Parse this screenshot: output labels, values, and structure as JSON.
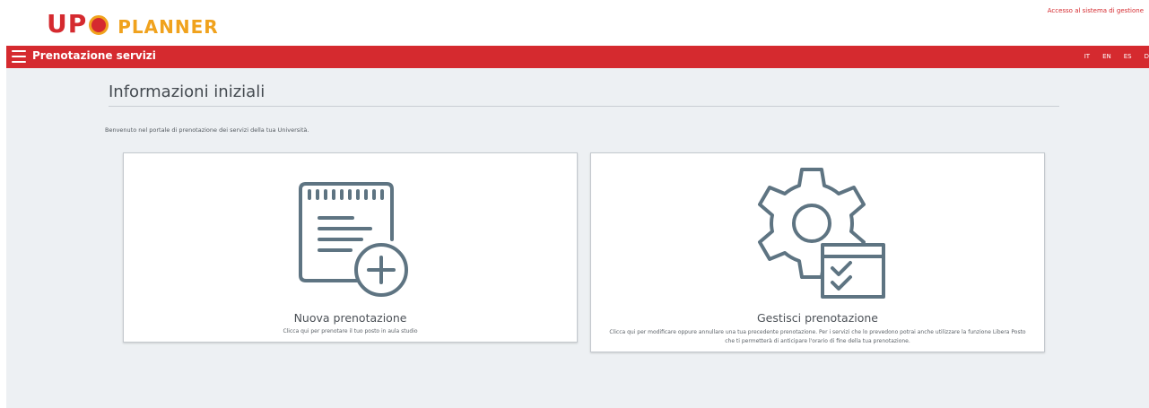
{
  "header": {
    "logo_upo": "UP",
    "logo_planner": "PLANNER",
    "admin_link": "Accesso al sistema di gestione"
  },
  "navbar": {
    "title": "Prenotazione servizi",
    "languages": [
      "IT",
      "EN",
      "ES",
      "D"
    ]
  },
  "main": {
    "page_title": "Informazioni iniziali",
    "intro": "Benvenuto nel portale di prenotazione dei servizi della tua Università.",
    "cards": [
      {
        "icon": "new-booking-icon",
        "title": "Nuova prenotazione",
        "description": "Clicca qui per prenotare il tuo posto in aula studio"
      },
      {
        "icon": "manage-booking-gear-icon",
        "title": "Gestisci prenotazione",
        "description": "Clicca qui per modificare oppure annullare una tua precedente prenotazione. Per i servizi che lo prevedono potrai anche utilizzare la funzione Libera Posto che ti permetterà di anticipare l'orario di fine della tua prenotazione."
      }
    ]
  },
  "colors": {
    "brand_red": "#d52a2f",
    "brand_orange": "#f0a21d",
    "icon_slate": "#5e7482",
    "background": "#edf0f3"
  }
}
